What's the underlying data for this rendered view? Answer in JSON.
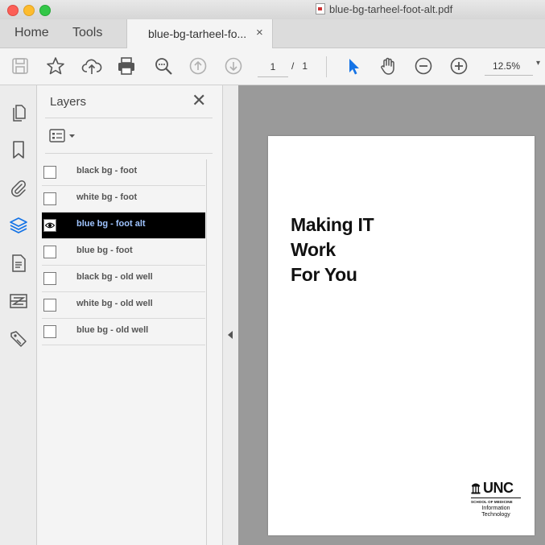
{
  "window": {
    "title": "blue-bg-tarheel-foot-alt.pdf"
  },
  "tabs": {
    "home": "Home",
    "tools": "Tools",
    "document": "blue-bg-tarheel-fo...",
    "close_glyph": "×"
  },
  "toolbar": {
    "page_current": "1",
    "page_separator": "/",
    "page_total": "1",
    "zoom": "12.5%",
    "zoom_caret": "▾",
    "selected_tool_color": "#1473e6"
  },
  "layers_panel": {
    "title": "Layers",
    "close_glyph": "✕",
    "items": [
      {
        "label": "black bg - foot",
        "visible": false,
        "selected": false
      },
      {
        "label": "white bg - foot",
        "visible": false,
        "selected": false
      },
      {
        "label": "blue bg - foot alt",
        "visible": true,
        "selected": true
      },
      {
        "label": "blue bg - foot",
        "visible": false,
        "selected": false
      },
      {
        "label": "black bg - old well",
        "visible": false,
        "selected": false
      },
      {
        "label": "white bg - old well",
        "visible": false,
        "selected": false
      },
      {
        "label": "blue bg - old well",
        "visible": false,
        "selected": false
      }
    ]
  },
  "rail": {
    "active_color": "#1473e6",
    "icons": [
      "pages-icon",
      "bookmark-icon",
      "attachment-icon",
      "layers-icon",
      "document-properties-icon",
      "compare-icon",
      "tag-icon"
    ]
  },
  "document": {
    "headline": [
      "Making IT",
      "Work",
      "For You"
    ],
    "logo": {
      "wordmark": "UNC",
      "school": "SCHOOL OF MEDICINE",
      "dept_line1": "Information",
      "dept_line2": "Technology"
    }
  }
}
